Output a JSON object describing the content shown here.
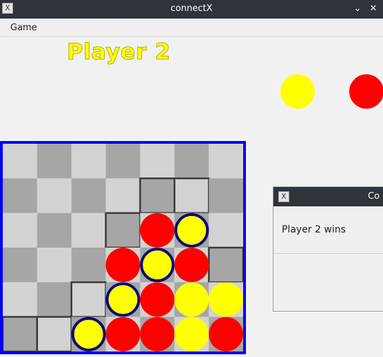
{
  "window": {
    "title": "connectX",
    "icon": "x-app-icon",
    "controls": [
      "chevron-down-icon",
      "close-icon"
    ]
  },
  "menu": {
    "items": [
      {
        "label": "Game"
      }
    ]
  },
  "status": {
    "current_player_label": "Player 2",
    "label_color": "#ffff00"
  },
  "legend": {
    "player_colors": [
      "#ffff00",
      "#ff0000"
    ]
  },
  "board": {
    "columns": 7,
    "rows": 6,
    "frame_color": "#0000ff",
    "highlight_color": "#0a0a7a",
    "grid": [
      [
        null,
        null,
        null,
        null,
        null,
        null,
        null
      ],
      [
        null,
        null,
        null,
        null,
        null,
        null,
        null
      ],
      [
        null,
        null,
        null,
        null,
        "R",
        "Y",
        null
      ],
      [
        null,
        null,
        null,
        "R",
        "Y",
        "R",
        null
      ],
      [
        null,
        null,
        null,
        "Y",
        "R",
        "Y",
        "Y"
      ],
      [
        null,
        null,
        "Y",
        "R",
        "R",
        "Y",
        "R"
      ]
    ],
    "winning_cells": [
      [
        5,
        2
      ],
      [
        4,
        3
      ],
      [
        3,
        4
      ],
      [
        2,
        5
      ]
    ],
    "outlined_cells": [
      [
        1,
        4
      ],
      [
        1,
        5
      ],
      [
        2,
        3
      ],
      [
        3,
        6
      ],
      [
        4,
        2
      ],
      [
        5,
        0
      ],
      [
        5,
        1
      ]
    ]
  },
  "dialog": {
    "title_fragment": "Co",
    "message": "Player 2 wins"
  }
}
